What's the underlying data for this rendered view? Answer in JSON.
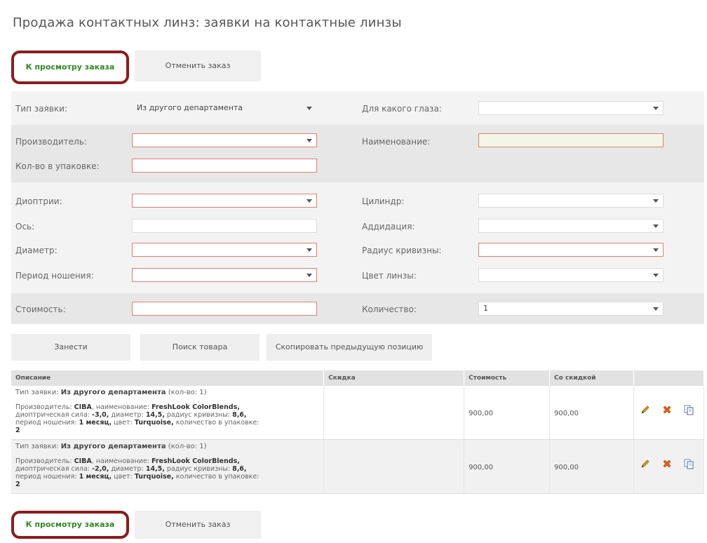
{
  "page": {
    "title": "Продажа контактных линз: заявки на контактные линзы"
  },
  "tabs": {
    "view_order": "К просмотру заказа",
    "cancel_order": "Отменить заказ"
  },
  "form": {
    "order_type": {
      "label": "Тип заявки:",
      "value": "Из другого департамента"
    },
    "eye": {
      "label": "Для какого глаза:",
      "value": ""
    },
    "manufacturer": {
      "label": "Производитель:",
      "value": ""
    },
    "name": {
      "label": "Наименование:",
      "value": ""
    },
    "pack_qty": {
      "label": "Кол-во в упаковке:",
      "value": ""
    },
    "diopters": {
      "label": "Диоптрии:",
      "value": ""
    },
    "cylinder": {
      "label": "Цилиндр:",
      "value": ""
    },
    "axis": {
      "label": "Ось:",
      "value": ""
    },
    "addition": {
      "label": "Аддидация:",
      "value": ""
    },
    "diameter": {
      "label": "Диаметр:",
      "value": ""
    },
    "curvature": {
      "label": "Радиус кривизны:",
      "value": ""
    },
    "wear_period": {
      "label": "Период ношения:",
      "value": ""
    },
    "lens_color": {
      "label": "Цвет линзы:",
      "value": ""
    },
    "cost": {
      "label": "Стоимость:",
      "value": ""
    },
    "quantity": {
      "label": "Количество:",
      "value": "1"
    }
  },
  "actions": {
    "submit": "Занести",
    "search": "Поиск товара",
    "copy_prev": "Скопировать предыдущую позицию"
  },
  "table": {
    "headers": [
      "Описание",
      "Скидка",
      "Стоимость",
      "Со скидкой"
    ],
    "rows": [
      {
        "type_label": "Тип заявки:",
        "type_value": "Из другого департамента",
        "type_suffix": "(кол-во: 1)",
        "manufacturer_label": "Производитель:",
        "manufacturer": "CIBA",
        "name_label": "наименование:",
        "name": "FreshLook ColorBlends,",
        "power_label": "диоптрическая сила:",
        "power": "-3,0,",
        "diameter_label": "диаметр:",
        "diameter": "14,5,",
        "radius_label": "радиус кривизны:",
        "radius": "8,6,",
        "period_label": "период ношения:",
        "period": "1 месяц,",
        "color_label": "цвет:",
        "color": "Turquoise,",
        "pack_label": "количество в упаковке:",
        "pack": "2",
        "discount": "",
        "cost": "900,00",
        "discounted": "900,00"
      },
      {
        "type_label": "Тип заявки:",
        "type_value": "Из другого департамента",
        "type_suffix": "(кол-во: 1)",
        "manufacturer_label": "Производитель:",
        "manufacturer": "CIBA",
        "name_label": "наименование:",
        "name": "FreshLook ColorBlends,",
        "power_label": "диоптрическая сила:",
        "power": "-2,0,",
        "diameter_label": "диаметр:",
        "diameter": "14,5,",
        "radius_label": "радиус кривизны:",
        "radius": "8,6,",
        "period_label": "период ношения:",
        "period": "1 месяц,",
        "color_label": "цвет:",
        "color": "Turquoise,",
        "pack_label": "количество в упаковке:",
        "pack": "2",
        "discount": "",
        "cost": "900,00",
        "discounted": "900,00"
      }
    ]
  },
  "icons": {
    "edit": "pencil-icon",
    "delete": "delete-x-icon",
    "copy": "copy-icon"
  },
  "colors": {
    "accent_green": "#2d8a1e",
    "highlight_border": "#8c1c1c",
    "required_border": "#e08070"
  }
}
